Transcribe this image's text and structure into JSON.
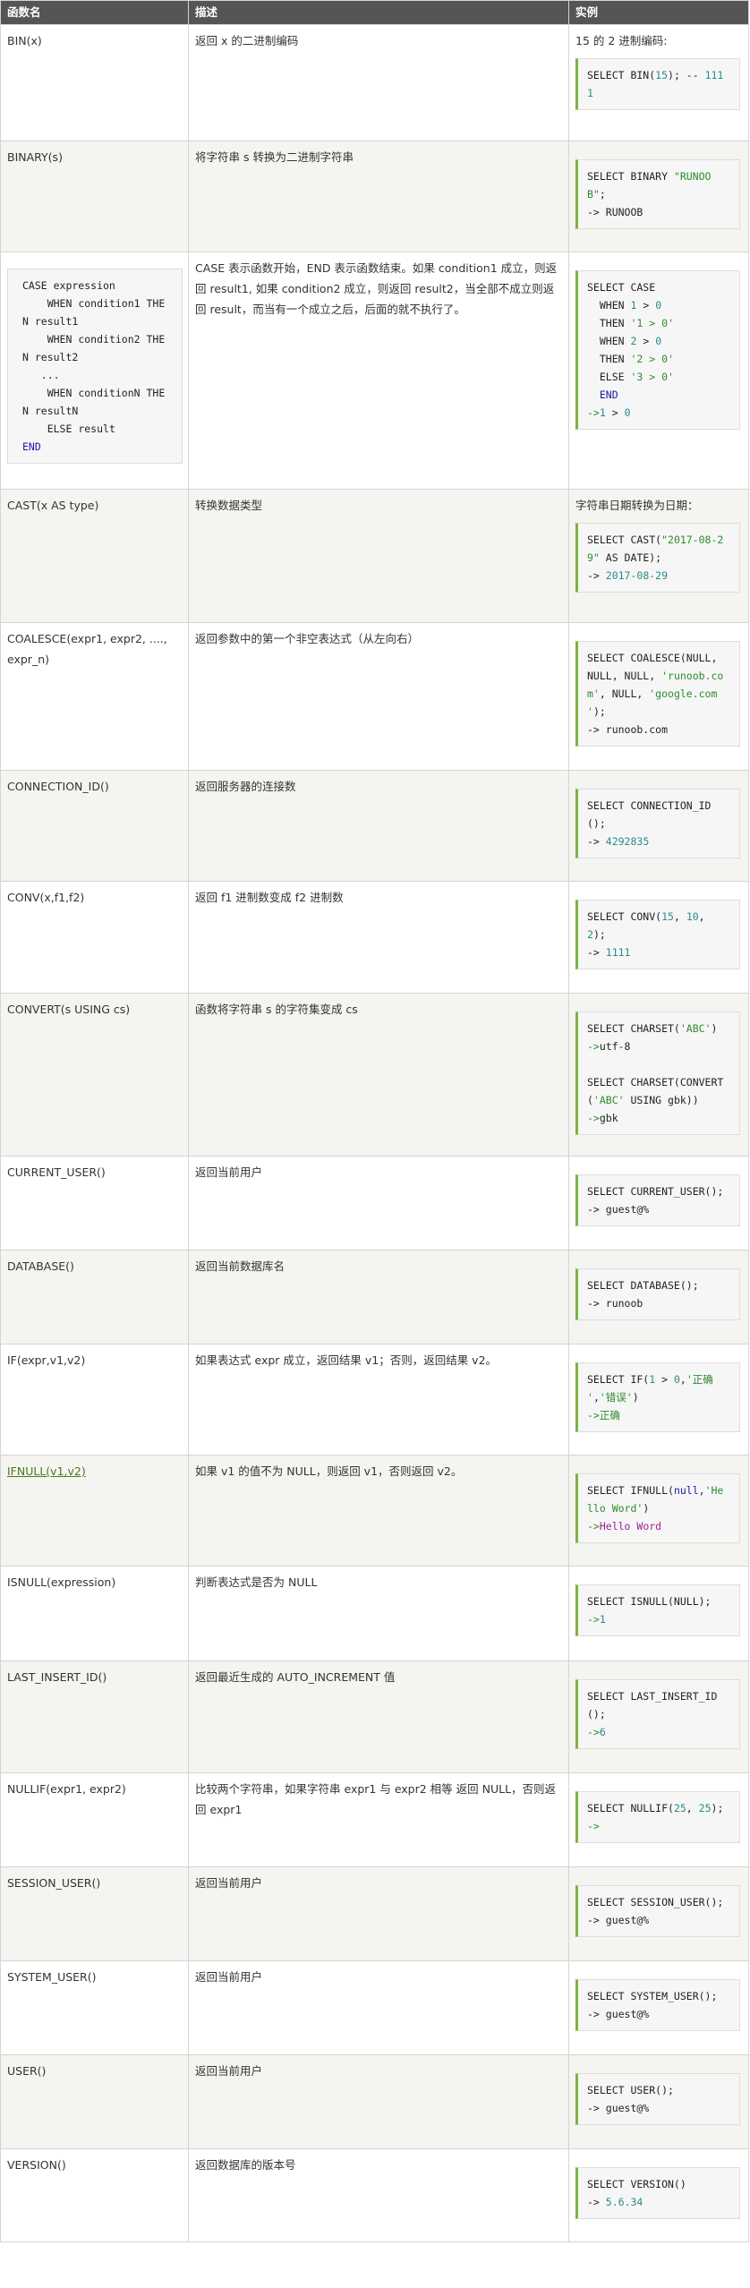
{
  "headers": {
    "name": "函数名",
    "desc": "描述",
    "example": "实例"
  },
  "rows": [
    {
      "name": "BIN(x)",
      "desc": "返回 x 的二进制编码",
      "example_title": "15 的 2 进制编码:",
      "code": [
        [
          {
            "t": "SELECT BIN("
          },
          {
            "t": "15",
            "c": "lit"
          },
          {
            "t": "); -- "
          },
          {
            "t": "111",
            "c": "lit"
          }
        ],
        [
          {
            "t": "1",
            "c": "lit"
          }
        ]
      ]
    },
    {
      "name": "BINARY(s)",
      "desc": "将字符串 s 转换为二进制字符串",
      "code": [
        [
          {
            "t": "SELECT BINARY "
          },
          {
            "t": "\"RUNOO",
            "c": "str"
          }
        ],
        [
          {
            "t": "B\"",
            "c": "str"
          },
          {
            "t": ";"
          }
        ],
        [
          {
            "t": "-> RUNOOB"
          }
        ]
      ]
    },
    {
      "name_code": [
        "CASE expression",
        "    WHEN condition1 THE",
        "N result1",
        "    WHEN condition2 THE",
        "N result2",
        "   ...",
        "    WHEN conditionN THE",
        "N resultN",
        "    ELSE result",
        "END"
      ],
      "desc": "CASE 表示函数开始，END 表示函数结束。如果 condition1 成立，则返回 result1, 如果 condition2 成立，则返回 result2，当全部不成立则返回 result，而当有一个成立之后，后面的就不执行了。",
      "code": [
        [
          {
            "t": "SELECT CASE"
          }
        ],
        [
          {
            "t": "  WHEN "
          },
          {
            "t": "1",
            "c": "lit"
          },
          {
            "t": " > "
          },
          {
            "t": "0",
            "c": "lit"
          }
        ],
        [
          {
            "t": "  THEN "
          },
          {
            "t": "'1 > 0'",
            "c": "str"
          }
        ],
        [
          {
            "t": "  WHEN "
          },
          {
            "t": "2",
            "c": "lit"
          },
          {
            "t": " > "
          },
          {
            "t": "0",
            "c": "lit"
          }
        ],
        [
          {
            "t": "  THEN "
          },
          {
            "t": "'2 > 0'",
            "c": "str"
          }
        ],
        [
          {
            "t": "  ELSE "
          },
          {
            "t": "'3 > 0'",
            "c": "str"
          }
        ],
        [
          {
            "t": "  "
          },
          {
            "t": "END",
            "c": "kw"
          }
        ],
        [
          {
            "t": "->",
            "c": "arr"
          },
          {
            "t": "1",
            "c": "lit"
          },
          {
            "t": " > "
          },
          {
            "t": "0",
            "c": "lit"
          }
        ]
      ]
    },
    {
      "name": "CAST(x AS type)",
      "desc": "转换数据类型",
      "example_title": "字符串日期转换为日期：",
      "code": [
        [
          {
            "t": "SELECT CAST("
          },
          {
            "t": "\"2017-08-2",
            "c": "str"
          }
        ],
        [
          {
            "t": "9\"",
            "c": "str"
          },
          {
            "t": " AS DATE);"
          }
        ],
        [
          {
            "t": "-> "
          },
          {
            "t": "2017-08-29",
            "c": "lit"
          }
        ]
      ]
    },
    {
      "name": "COALESCE(expr1, expr2, ...., expr_n)",
      "desc": "返回参数中的第一个非空表达式（从左向右）",
      "code": [
        [
          {
            "t": "SELECT COALESCE(NULL,"
          }
        ],
        [
          {
            "t": "NULL, NULL, "
          },
          {
            "t": "'runoob.co",
            "c": "str"
          }
        ],
        [
          {
            "t": "m'",
            "c": "str"
          },
          {
            "t": ", NULL, "
          },
          {
            "t": "'google.com",
            "c": "str"
          }
        ],
        [
          {
            "t": "'",
            "c": "str"
          },
          {
            "t": ");"
          }
        ],
        [
          {
            "t": "-> runoob.com"
          }
        ]
      ]
    },
    {
      "name": "CONNECTION_ID()",
      "desc": "返回服务器的连接数",
      "code": [
        [
          {
            "t": "SELECT CONNECTION_ID"
          }
        ],
        [
          {
            "t": "();"
          }
        ],
        [
          {
            "t": "-> "
          },
          {
            "t": "4292835",
            "c": "lit"
          }
        ]
      ]
    },
    {
      "name": "CONV(x,f1,f2)",
      "desc": "返回 f1 进制数变成 f2 进制数",
      "code": [
        [
          {
            "t": "SELECT CONV("
          },
          {
            "t": "15",
            "c": "lit"
          },
          {
            "t": ", "
          },
          {
            "t": "10",
            "c": "lit"
          },
          {
            "t": ","
          }
        ],
        [
          {
            "t": "2",
            "c": "lit"
          },
          {
            "t": ");"
          }
        ],
        [
          {
            "t": "-> "
          },
          {
            "t": "1111",
            "c": "lit"
          }
        ]
      ]
    },
    {
      "name": "CONVERT(s USING cs)",
      "desc": "函数将字符串 s 的字符集变成 cs",
      "code": [
        [
          {
            "t": "SELECT CHARSET("
          },
          {
            "t": "'ABC'",
            "c": "str"
          },
          {
            "t": ")"
          }
        ],
        [
          {
            "t": "->",
            "c": "arr"
          },
          {
            "t": "utf-8"
          }
        ],
        [
          {
            "t": ""
          }
        ],
        [
          {
            "t": "SELECT CHARSET(CONVERT"
          }
        ],
        [
          {
            "t": "("
          },
          {
            "t": "'ABC'",
            "c": "str"
          },
          {
            "t": " USING gbk))"
          }
        ],
        [
          {
            "t": "->",
            "c": "arr"
          },
          {
            "t": "gbk"
          }
        ]
      ]
    },
    {
      "name": "CURRENT_USER()",
      "desc": "返回当前用户",
      "code": [
        [
          {
            "t": "SELECT CURRENT_USER();"
          }
        ],
        [
          {
            "t": "-> guest@%"
          }
        ]
      ]
    },
    {
      "name": "DATABASE()",
      "desc": "返回当前数据库名",
      "code": [
        [
          {
            "t": "SELECT DATABASE();"
          }
        ],
        [
          {
            "t": "-> runoob"
          }
        ]
      ]
    },
    {
      "name": "IF(expr,v1,v2)",
      "desc": "如果表达式 expr 成立，返回结果 v1；否则，返回结果 v2。",
      "code": [
        [
          {
            "t": "SELECT IF("
          },
          {
            "t": "1",
            "c": "lit"
          },
          {
            "t": " > "
          },
          {
            "t": "0",
            "c": "lit"
          },
          {
            "t": ","
          },
          {
            "t": "'正确",
            "c": "str"
          }
        ],
        [
          {
            "t": "'",
            "c": "str"
          },
          {
            "t": ","
          },
          {
            "t": "'错误'",
            "c": "str"
          },
          {
            "t": ")"
          }
        ],
        [
          {
            "t": "->",
            "c": "arr"
          },
          {
            "t": "正确",
            "c": "str"
          }
        ]
      ]
    },
    {
      "name": "IFNULL(v1,v2)",
      "name_link": true,
      "desc": "如果 v1 的值不为 NULL，则返回 v1，否则返回 v2。",
      "code": [
        [
          {
            "t": "SELECT IFNULL("
          },
          {
            "t": "null",
            "c": "kw"
          },
          {
            "t": ","
          },
          {
            "t": "'He",
            "c": "str"
          }
        ],
        [
          {
            "t": "llo Word'",
            "c": "str"
          },
          {
            "t": ")"
          }
        ],
        [
          {
            "t": "->",
            "c": "arr"
          },
          {
            "t": "Hello Word",
            "c": "purple"
          }
        ]
      ]
    },
    {
      "name": "ISNULL(expression)",
      "desc": "判断表达式是否为 NULL",
      "code": [
        [
          {
            "t": "SELECT ISNULL(NULL);"
          }
        ],
        [
          {
            "t": "->",
            "c": "arr"
          },
          {
            "t": "1",
            "c": "lit"
          }
        ]
      ]
    },
    {
      "name": "LAST_INSERT_ID()",
      "desc": "返回最近生成的 AUTO_INCREMENT 值",
      "code": [
        [
          {
            "t": "SELECT LAST_INSERT_ID"
          }
        ],
        [
          {
            "t": "();"
          }
        ],
        [
          {
            "t": "->",
            "c": "arr"
          },
          {
            "t": "6",
            "c": "lit"
          }
        ]
      ]
    },
    {
      "name": "NULLIF(expr1, expr2)",
      "desc": "比较两个字符串，如果字符串 expr1 与 expr2 相等 返回 NULL，否则返回 expr1",
      "code": [
        [
          {
            "t": "SELECT NULLIF("
          },
          {
            "t": "25",
            "c": "lit"
          },
          {
            "t": ", "
          },
          {
            "t": "25",
            "c": "lit"
          },
          {
            "t": ");"
          }
        ],
        [
          {
            "t": "->",
            "c": "arr"
          }
        ]
      ]
    },
    {
      "name": "SESSION_USER()",
      "desc": "返回当前用户",
      "code": [
        [
          {
            "t": "SELECT SESSION_USER();"
          }
        ],
        [
          {
            "t": "-> guest@%"
          }
        ]
      ]
    },
    {
      "name": "SYSTEM_USER()",
      "desc": "返回当前用户",
      "code": [
        [
          {
            "t": "SELECT SYSTEM_USER();"
          }
        ],
        [
          {
            "t": "-> guest@%"
          }
        ]
      ]
    },
    {
      "name": "USER()",
      "desc": "返回当前用户",
      "code": [
        [
          {
            "t": "SELECT USER();"
          }
        ],
        [
          {
            "t": "-> guest@%"
          }
        ]
      ]
    },
    {
      "name": "VERSION()",
      "desc": "返回数据库的版本号",
      "code": [
        [
          {
            "t": "SELECT VERSION()"
          }
        ],
        [
          {
            "t": "-> "
          },
          {
            "t": "5.6.34",
            "c": "lit"
          }
        ]
      ]
    }
  ],
  "colors": {
    "header_bg": "#555555",
    "alt_row_bg": "#f4f4f0",
    "link": "#4a7a1a",
    "code_border_accent": "#7cb342"
  }
}
